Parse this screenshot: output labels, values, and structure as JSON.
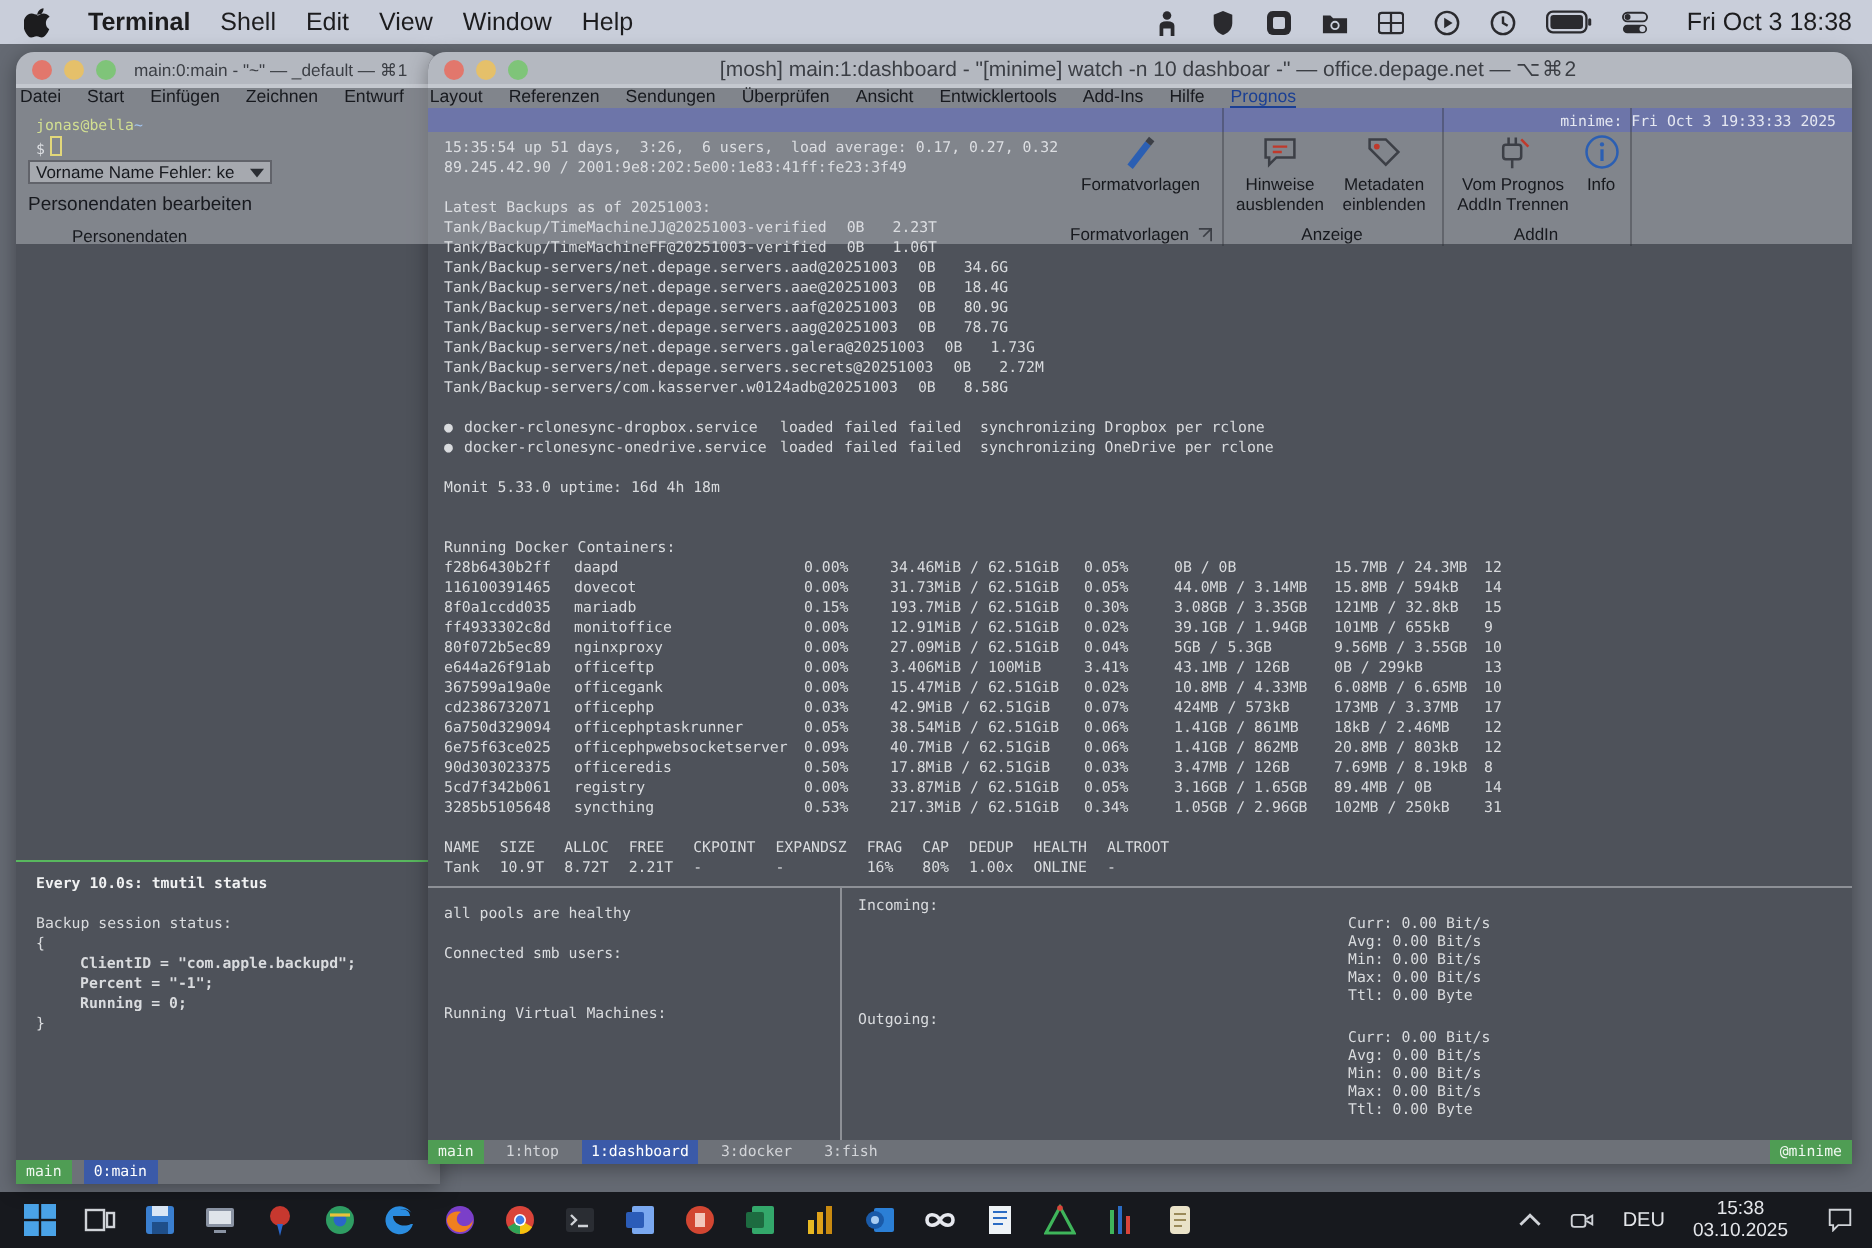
{
  "menu_bar": {
    "app": "Terminal",
    "items": [
      "Shell",
      "Edit",
      "View",
      "Window",
      "Help"
    ],
    "clock": "Fri Oct 3 18:38"
  },
  "main_window": {
    "title": "main:0:main - \"~\" — _default — ⌘1",
    "prompt": {
      "user_host": "jonas@bella",
      "cwd": "~",
      "symbol": "$"
    },
    "watch": {
      "header": "Every 10.0s: tmutil status",
      "session": {
        "title": "Backup session status:",
        "open": "{",
        "fields": [
          "ClientID = \"com.apple.backupd\";",
          "Percent = \"-1\";",
          "Running = 0;"
        ],
        "close": "}"
      }
    },
    "status_bar": {
      "session": "main",
      "windows": [
        {
          "label": "0:main",
          "selected": true
        }
      ]
    }
  },
  "dashboard_window": {
    "title": "[mosh] main:1:dashboard - \"[minime] watch -n 10 dashboar -\" — office.depage.net — ⌥⌘2",
    "header": "minime: Fri Oct  3 19:33:33 2025",
    "uptime": "15:35:54 up 51 days,  3:26,  6 users,  load average: 0.17, 0.27, 0.32",
    "addresses": "89.245.42.90 / 2001:9e8:202:5e00:1e83:41ff:fe23:3f49",
    "backups": {
      "title": "Latest Backups as of 20251003:",
      "rows": [
        {
          "name": "Tank/Backup/TimeMachineJJ@20251003-verified",
          "used": "0B",
          "refer": "2.23T"
        },
        {
          "name": "Tank/Backup/TimeMachineFF@20251003-verified",
          "used": "0B",
          "refer": "1.06T"
        },
        {
          "name": "Tank/Backup-servers/net.depage.servers.aad@20251003",
          "used": "0B",
          "refer": "34.6G"
        },
        {
          "name": "Tank/Backup-servers/net.depage.servers.aae@20251003",
          "used": "0B",
          "refer": "18.4G"
        },
        {
          "name": "Tank/Backup-servers/net.depage.servers.aaf@20251003",
          "used": "0B",
          "refer": "80.9G"
        },
        {
          "name": "Tank/Backup-servers/net.depage.servers.aag@20251003",
          "used": "0B",
          "refer": "78.7G"
        },
        {
          "name": "Tank/Backup-servers/net.depage.servers.galera@20251003",
          "used": "0B",
          "refer": "1.73G"
        },
        {
          "name": "Tank/Backup-servers/net.depage.servers.secrets@20251003",
          "used": "0B",
          "refer": "2.72M"
        },
        {
          "name": "Tank/Backup-servers/com.kasserver.w0124adb@20251003",
          "used": "0B",
          "refer": "8.58G"
        }
      ]
    },
    "services": [
      {
        "bullet": "●",
        "unit": "docker-rclonesync-dropbox.service",
        "load": "loaded",
        "active": "failed",
        "sub": "failed",
        "description": "synchronizing Dropbox per rclone"
      },
      {
        "bullet": "●",
        "unit": "docker-rclonesync-onedrive.service",
        "load": "loaded",
        "active": "failed",
        "sub": "failed",
        "description": "synchronizing OneDrive per rclone"
      }
    ],
    "monit": "Monit 5.33.0 uptime: 16d 4h 18m",
    "containers": {
      "title": "Running Docker Containers:",
      "rows": [
        {
          "id": "f28b6430b2ff",
          "name": "daapd",
          "cpu": "0.00%",
          "mem": "34.46MiB / 62.51GiB",
          "mem_pct": "0.05%",
          "net_io": "0B / 0B",
          "block_io": "15.7MB / 24.3MB",
          "pids": "12"
        },
        {
          "id": "116100391465",
          "name": "dovecot",
          "cpu": "0.00%",
          "mem": "31.73MiB / 62.51GiB",
          "mem_pct": "0.05%",
          "net_io": "44.0MB / 3.14MB",
          "block_io": "15.8MB / 594kB",
          "pids": "14"
        },
        {
          "id": "8f0a1ccdd035",
          "name": "mariadb",
          "cpu": "0.15%",
          "mem": "193.7MiB / 62.51GiB",
          "mem_pct": "0.30%",
          "net_io": "3.08GB / 3.35GB",
          "block_io": "121MB / 32.8kB",
          "pids": "15"
        },
        {
          "id": "ff4933302c8d",
          "name": "monitoffice",
          "cpu": "0.00%",
          "mem": "12.91MiB / 62.51GiB",
          "mem_pct": "0.02%",
          "net_io": "39.1GB / 1.94GB",
          "block_io": "101MB / 655kB",
          "pids": "9"
        },
        {
          "id": "80f072b5ec89",
          "name": "nginxproxy",
          "cpu": "0.00%",
          "mem": "27.09MiB / 62.51GiB",
          "mem_pct": "0.04%",
          "net_io": "5GB / 5.3GB",
          "block_io": "9.56MB / 3.55GB",
          "pids": "10"
        },
        {
          "id": "e644a26f91ab",
          "name": "officeftp",
          "cpu": "0.00%",
          "mem": "3.406MiB / 100MiB",
          "mem_pct": "3.41%",
          "net_io": "43.1MB / 126B",
          "block_io": "0B / 299kB",
          "pids": "13"
        },
        {
          "id": "367599a19a0e",
          "name": "officegank",
          "cpu": "0.00%",
          "mem": "15.47MiB / 62.51GiB",
          "mem_pct": "0.02%",
          "net_io": "10.8MB / 4.33MB",
          "block_io": "6.08MB / 6.65MB",
          "pids": "10"
        },
        {
          "id": "cd2386732071",
          "name": "officephp",
          "cpu": "0.03%",
          "mem": "42.9MiB / 62.51GiB",
          "mem_pct": "0.07%",
          "net_io": "424MB / 573kB",
          "block_io": "173MB / 3.37MB",
          "pids": "17"
        },
        {
          "id": "6a750d329094",
          "name": "officephptaskrunner",
          "cpu": "0.05%",
          "mem": "38.54MiB / 62.51GiB",
          "mem_pct": "0.06%",
          "net_io": "1.41GB / 861MB",
          "block_io": "18kB / 2.46MB",
          "pids": "12"
        },
        {
          "id": "6e75f63ce025",
          "name": "officephpwebsocketserver",
          "cpu": "0.09%",
          "mem": "40.7MiB / 62.51GiB",
          "mem_pct": "0.06%",
          "net_io": "1.41GB / 862MB",
          "block_io": "20.8MB / 803kB",
          "pids": "12"
        },
        {
          "id": "90d303023375",
          "name": "officeredis",
          "cpu": "0.50%",
          "mem": "17.8MiB / 62.51GiB",
          "mem_pct": "0.03%",
          "net_io": "3.47MB / 126B",
          "block_io": "7.69MB / 8.19kB",
          "pids": "8"
        },
        {
          "id": "5cd7f342b061",
          "name": "registry",
          "cpu": "0.00%",
          "mem": "33.87MiB / 62.51GiB",
          "mem_pct": "0.05%",
          "net_io": "3.16GB / 1.65GB",
          "block_io": "89.4MB / 0B",
          "pids": "14"
        },
        {
          "id": "3285b5105648",
          "name": "syncthing",
          "cpu": "0.53%",
          "mem": "217.3MiB / 62.51GiB",
          "mem_pct": "0.34%",
          "net_io": "1.05GB / 2.96GB",
          "block_io": "102MB / 250kB",
          "pids": "31"
        }
      ]
    },
    "zpool": {
      "columns": [
        "NAME",
        "SIZE",
        "ALLOC",
        "FREE",
        "CKPOINT",
        "EXPANDSZ",
        "FRAG",
        "CAP",
        "DEDUP",
        "HEALTH",
        "ALTROOT"
      ],
      "rows": [
        [
          "Tank",
          "10.9T",
          "8.72T",
          "2.21T",
          "-",
          "-",
          "16%",
          "80%",
          "1.00x",
          "ONLINE",
          "-"
        ]
      ]
    },
    "pool_status": "all pools are healthy",
    "smb_title": "Connected smb users:",
    "vm_title": "Running Virtual Machines:",
    "network": [
      {
        "title": "Incoming:",
        "stats": [
          "Curr: 0.00 Bit/s",
          "Avg: 0.00 Bit/s",
          "Min: 0.00 Bit/s",
          "Max: 0.00 Bit/s",
          "Ttl: 0.00 Byte"
        ]
      },
      {
        "title": "Outgoing:",
        "stats": [
          "Curr: 0.00 Bit/s",
          "Avg: 0.00 Bit/s",
          "Min: 0.00 Bit/s",
          "Max: 0.00 Bit/s",
          "Ttl: 0.00 Byte"
        ]
      }
    ],
    "status_bar": {
      "session": "main",
      "windows": [
        {
          "label": "1:htop",
          "selected": false
        },
        {
          "label": "1:dashboard",
          "selected": true
        },
        {
          "label": "3:docker",
          "selected": false
        },
        {
          "label": "3:fish",
          "selected": false
        }
      ],
      "host": "@minime"
    }
  },
  "word_overlay": {
    "tabs": [
      {
        "label": "Datei",
        "selected": false
      },
      {
        "label": "Start",
        "selected": false
      },
      {
        "label": "Einfügen",
        "selected": false
      },
      {
        "label": "Zeichnen",
        "selected": false
      },
      {
        "label": "Entwurf",
        "selected": false
      },
      {
        "label": "Layout",
        "selected": false
      },
      {
        "label": "Referenzen",
        "selected": false
      },
      {
        "label": "Sendungen",
        "selected": false
      },
      {
        "label": "Überprüfen",
        "selected": false
      },
      {
        "label": "Ansicht",
        "selected": false
      },
      {
        "label": "Entwicklertools",
        "selected": false
      },
      {
        "label": "Add-Ins",
        "selected": false
      },
      {
        "label": "Hilfe",
        "selected": false
      },
      {
        "label": "Prognos",
        "selected": true
      }
    ],
    "person_field": {
      "value": "Vorname Name Fehler: ke"
    },
    "person_button": "Personendaten bearbeiten",
    "person_group": "Personendaten",
    "groups": [
      {
        "label": "Formatvorlagen",
        "launcher": true,
        "buttons": [
          {
            "kind": "styles",
            "label": "Formatvorlagen"
          }
        ]
      },
      {
        "label": "Anzeige",
        "launcher": false,
        "buttons": [
          {
            "kind": "hints",
            "label": "Hinweise ausblenden"
          },
          {
            "kind": "metadata",
            "label": "Metadaten einblenden"
          }
        ]
      },
      {
        "label": "AddIn",
        "launcher": false,
        "buttons": [
          {
            "kind": "disconnect",
            "label": "Vom Prognos AddIn Trennen"
          },
          {
            "kind": "info",
            "label": "Info"
          }
        ]
      }
    ]
  },
  "taskbar": {
    "language": "DEU",
    "time": "15:38",
    "date": "03.10.2025"
  }
}
